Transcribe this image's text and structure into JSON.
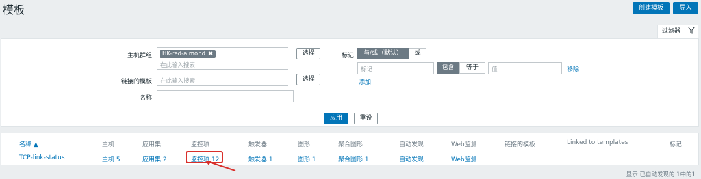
{
  "header": {
    "title": "模板",
    "create_label": "创建模板",
    "import_label": "导入"
  },
  "filter": {
    "tab_label": "过滤器",
    "host_group_label": "主机群组",
    "host_group_tag": "HK-red-almond",
    "host_group_placeholder": "在此输入搜索",
    "select_label": "选择",
    "linked_template_label": "链接的模板",
    "linked_template_placeholder": "在此输入搜索",
    "name_label": "名称",
    "tags_label": "标记",
    "and_or_label": "与/或（默认）",
    "or_label": "或",
    "tag_placeholder": "标记",
    "contains_label": "包含",
    "equals_label": "等于",
    "value_placeholder": "值",
    "remove_label": "移除",
    "add_label": "添加",
    "apply_label": "应用",
    "reset_label": "重设"
  },
  "table": {
    "headers": [
      "名称 ▲",
      "主机",
      "应用集",
      "监控项",
      "触发器",
      "图形",
      "聚合图形",
      "自动发现",
      "Web监测",
      "链接的模板",
      "Linked to templates",
      "标记"
    ],
    "row": {
      "name": "TCP-link-status",
      "hosts": "主机 5",
      "apps": "应用集 2",
      "items": "监控项 12",
      "triggers": "触发器 1",
      "graphs": "图形 1",
      "screens": "聚合图形 1",
      "discovery": "自动发现",
      "web": "Web监测"
    },
    "footer": "显示 已自动发现的 1中的1"
  }
}
